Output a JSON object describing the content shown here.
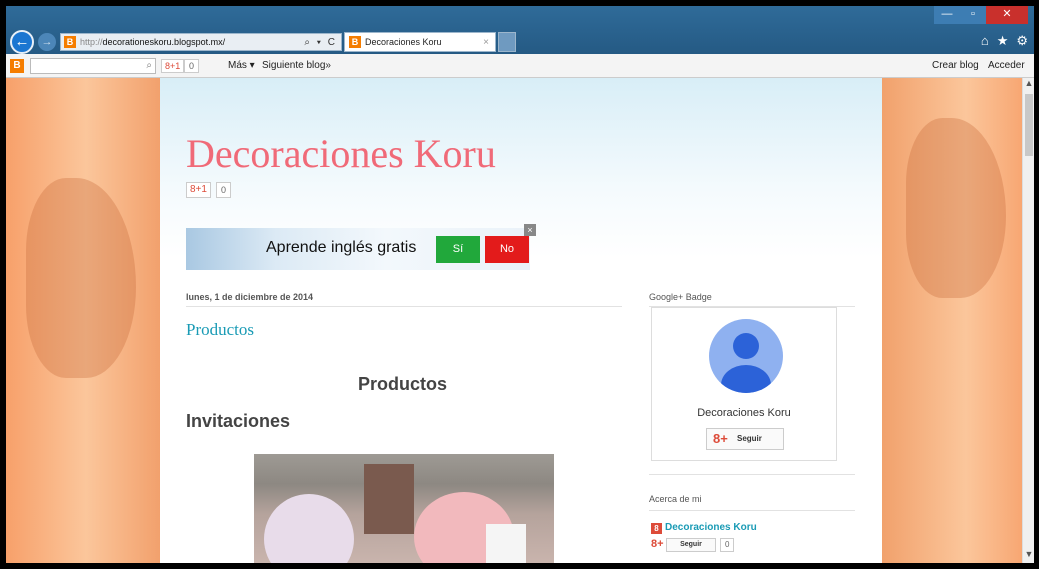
{
  "browser": {
    "address_proto": "http://",
    "address_host": "decorationeskoru.blogspot.mx/",
    "address_buttons": "⌕ ▾ C",
    "tab_title": "Decoraciones Koru",
    "tab_close": "×",
    "window": {
      "minimize": "—",
      "maximize": "▫",
      "close": "✕"
    },
    "tool_icons": {
      "home": "⌂",
      "favorites": "★",
      "settings": "⚙"
    },
    "back": "←",
    "forward": "→"
  },
  "navbar": {
    "gplus_label": "8+1",
    "gplus_count": "0",
    "more_label": "Más ▾",
    "next_blog_label": "Siguiente blog»",
    "create_blog_label": "Crear blog",
    "login_label": "Acceder"
  },
  "header": {
    "blog_title": "Decoraciones Koru",
    "gplus_label": "8+1",
    "gplus_count": "0"
  },
  "ad": {
    "text": "Aprende inglés gratis",
    "yes_label": "Sí",
    "no_label": "No",
    "close": "×"
  },
  "post": {
    "date": "lunes, 1 de diciembre de 2014",
    "title": "Productos",
    "heading_center": "Productos",
    "heading_left": "Invitaciones"
  },
  "sidebar": {
    "badge_heading": "Google+ Badge",
    "badge_name": "Decoraciones Koru",
    "badge_follow_icon": "8+",
    "badge_follow_label": "Seguir",
    "about_heading": "Acerca de mi",
    "about_name": "Decoraciones Koru",
    "about_follow_icon": "8+",
    "about_follow_label": "Seguir",
    "about_count": "0"
  },
  "colors": {
    "blog_title": "#f06a78",
    "post_title": "#1a9bb5",
    "ad_yes": "#21a83b",
    "ad_no": "#e31b1b",
    "titlebar": "#2f6b99"
  }
}
